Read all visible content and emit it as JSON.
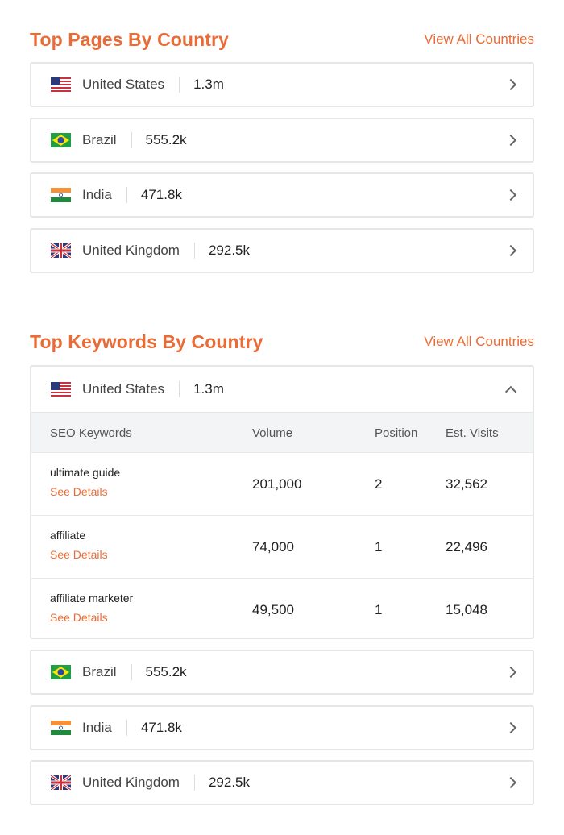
{
  "top_pages": {
    "title": "Top Pages By Country",
    "view_all": "View All Countries",
    "rows": [
      {
        "country": "United States",
        "value": "1.3m",
        "flag": "us-flag-icon"
      },
      {
        "country": "Brazil",
        "value": "555.2k",
        "flag": "brazil-flag-icon"
      },
      {
        "country": "India",
        "value": "471.8k",
        "flag": "india-flag-icon"
      },
      {
        "country": "United Kingdom",
        "value": "292.5k",
        "flag": "uk-flag-icon"
      }
    ]
  },
  "top_keywords": {
    "title": "Top Keywords By Country",
    "view_all": "View All Countries",
    "expanded": {
      "country": "United States",
      "value": "1.3m",
      "columns": [
        "SEO Keywords",
        "Volume",
        "Position",
        "Est. Visits"
      ],
      "rows": [
        {
          "keyword": "ultimate guide",
          "details": "See Details",
          "volume": "201,000",
          "position": "2",
          "visits": "32,562"
        },
        {
          "keyword": "affiliate",
          "details": "See Details",
          "volume": "74,000",
          "position": "1",
          "visits": "22,496"
        },
        {
          "keyword": "affiliate marketer",
          "details": "See Details",
          "volume": "49,500",
          "position": "1",
          "visits": "15,048"
        }
      ]
    },
    "rows": [
      {
        "country": "Brazil",
        "value": "555.2k",
        "flag": "brazil-flag-icon"
      },
      {
        "country": "India",
        "value": "471.8k",
        "flag": "india-flag-icon"
      },
      {
        "country": "United Kingdom",
        "value": "292.5k",
        "flag": "uk-flag-icon"
      }
    ]
  },
  "colors": {
    "accent": "#ea6b35",
    "border": "#e6e6e6",
    "table_header_bg": "#f2f4f5"
  }
}
